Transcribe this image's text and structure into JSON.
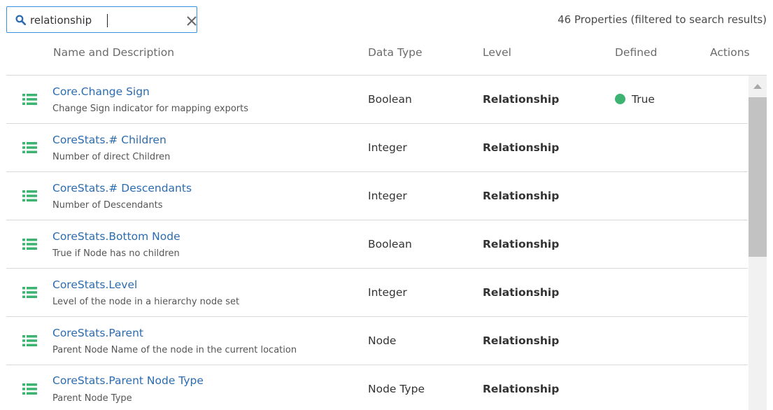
{
  "search": {
    "value": "relationship",
    "icon": "search-icon",
    "clear_icon": "close-icon",
    "accent_color": "#3c8fd8"
  },
  "result_count": "46 Properties (filtered to search results)",
  "columns": {
    "name": "Name and Description",
    "data_type": "Data Type",
    "level": "Level",
    "defined": "Defined",
    "actions": "Actions"
  },
  "rows": [
    {
      "name": "Core.Change Sign",
      "description": "Change Sign indicator for mapping exports",
      "data_type": "Boolean",
      "level": "Relationship",
      "defined": "True",
      "icon": "list-icon"
    },
    {
      "name": "CoreStats.# Children",
      "description": "Number of direct Children",
      "data_type": "Integer",
      "level": "Relationship",
      "defined": "",
      "icon": "list-icon"
    },
    {
      "name": "CoreStats.# Descendants",
      "description": "Number of Descendants",
      "data_type": "Integer",
      "level": "Relationship",
      "defined": "",
      "icon": "list-icon"
    },
    {
      "name": "CoreStats.Bottom Node",
      "description": "True if Node has no children",
      "data_type": "Boolean",
      "level": "Relationship",
      "defined": "",
      "icon": "list-icon"
    },
    {
      "name": "CoreStats.Level",
      "description": "Level of the node in a hierarchy node set",
      "data_type": "Integer",
      "level": "Relationship",
      "defined": "",
      "icon": "list-icon"
    },
    {
      "name": "CoreStats.Parent",
      "description": "Parent Node Name of the node in the current location",
      "data_type": "Node",
      "level": "Relationship",
      "defined": "",
      "icon": "list-icon"
    },
    {
      "name": "CoreStats.Parent Node Type",
      "description": "Parent Node Type",
      "data_type": "Node Type",
      "level": "Relationship",
      "defined": "",
      "icon": "list-icon"
    }
  ],
  "colors": {
    "link": "#2b6cb0",
    "icon_green": "#3cb371",
    "defined_dot": "#3cb371"
  }
}
